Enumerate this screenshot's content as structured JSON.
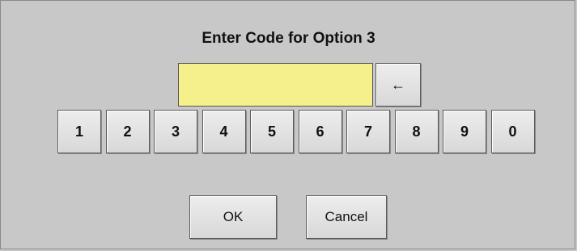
{
  "dialog": {
    "title": "Enter Code for Option 3",
    "code_value": "",
    "backspace_glyph": "←",
    "backspace_icon": "backspace-arrow-icon",
    "digits": [
      "1",
      "2",
      "3",
      "4",
      "5",
      "6",
      "7",
      "8",
      "9",
      "0"
    ],
    "ok_label": "OK",
    "cancel_label": "Cancel"
  },
  "colors": {
    "background": "#c8c8c8",
    "input_background": "#f5ef8c"
  }
}
